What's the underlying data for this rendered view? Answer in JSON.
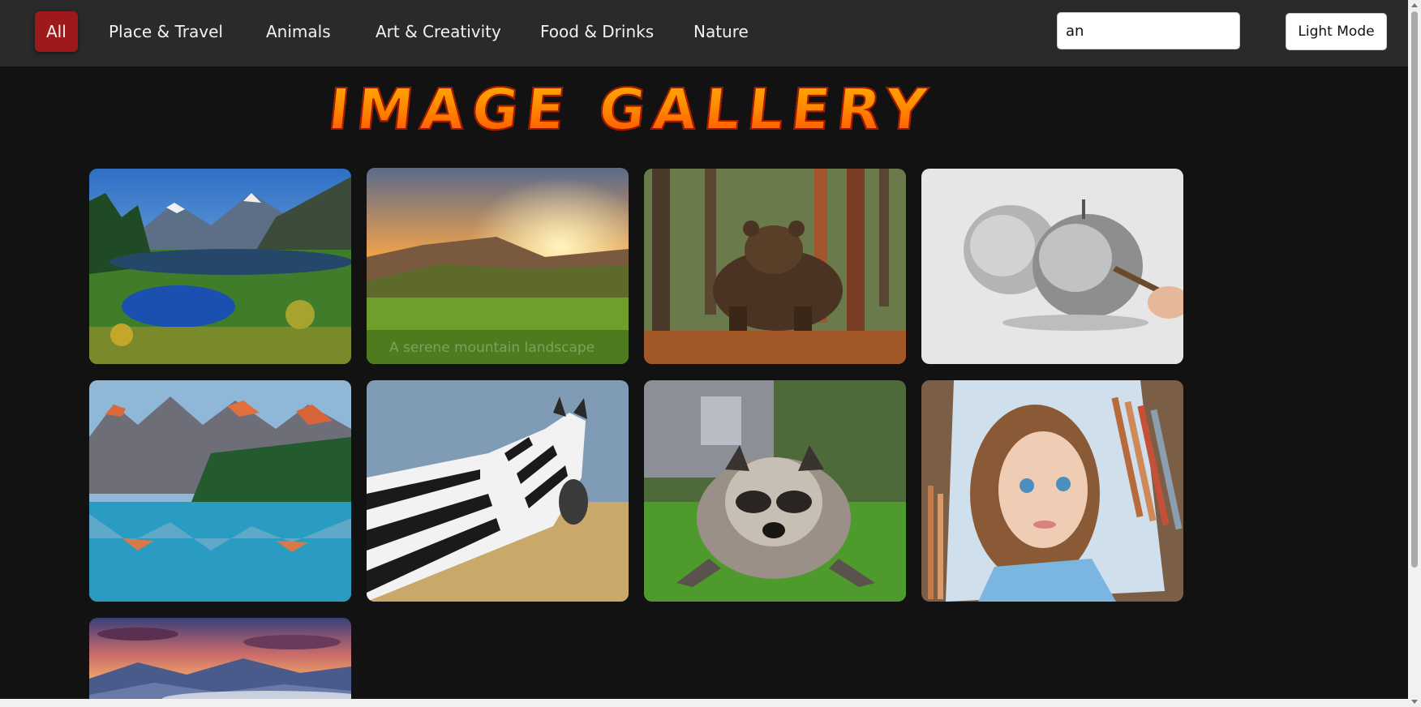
{
  "nav": {
    "items": [
      {
        "label": "All",
        "active": true
      },
      {
        "label": "Place & Travel"
      },
      {
        "label": "Animals"
      },
      {
        "label": "Art & Creativity"
      },
      {
        "label": "Food & Drinks"
      },
      {
        "label": "Nature"
      }
    ]
  },
  "search": {
    "value": "an"
  },
  "mode_toggle": {
    "label": "Light Mode"
  },
  "gallery": {
    "title": "IMAGE GALLERY",
    "images": [
      {
        "subject": "mountain lake with pine forest"
      },
      {
        "subject": "sunset over green mountain meadow",
        "caption": "A serene mountain landscape"
      },
      {
        "subject": "brown bear in forest"
      },
      {
        "subject": "pencil sketch of apples"
      },
      {
        "subject": "mountain lake reflection"
      },
      {
        "subject": "zebra in grass"
      },
      {
        "subject": "raccoon on grass"
      },
      {
        "subject": "pencil drawing of a girl with colored pencils"
      },
      {
        "subject": "sunset over misty mountains"
      }
    ]
  },
  "colors": {
    "background": "#121212",
    "topbar": "#2a2a2a",
    "active_nav": "#9e1a1a",
    "title_gradient": [
      "#ffb300",
      "#ff4800"
    ]
  }
}
